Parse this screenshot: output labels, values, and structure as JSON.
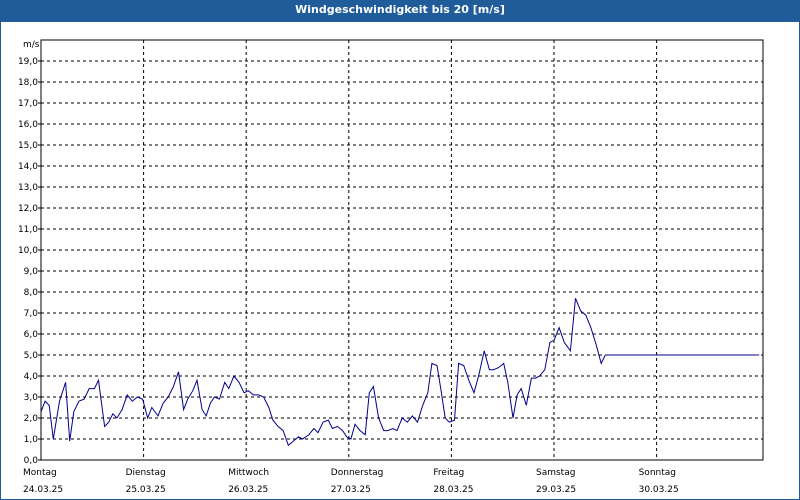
{
  "window": {
    "title": "Windgeschwindigkeit bis 20 [m/s]"
  },
  "chart_data": {
    "type": "line",
    "title": "Windgeschwindigkeit bis 20 [m/s]",
    "ylabel": "m/s",
    "ylim": [
      0,
      20
    ],
    "yticks": [
      "0,0",
      "1,0",
      "2,0",
      "3,0",
      "4,0",
      "5,0",
      "6,0",
      "7,0",
      "8,0",
      "9,0",
      "10,0",
      "11,0",
      "12,0",
      "13,0",
      "14,0",
      "15,0",
      "16,0",
      "17,0",
      "18,0",
      "19,0"
    ],
    "xlim_days": [
      0,
      7
    ],
    "grid": true,
    "line_color": "#00008b",
    "x_labels": [
      {
        "day": "Montag",
        "date": "24.03.25"
      },
      {
        "day": "Dienstag",
        "date": "25.03.25"
      },
      {
        "day": "Mittwoch",
        "date": "26.03.25"
      },
      {
        "day": "Donnerstag",
        "date": "27.03.25"
      },
      {
        "day": "Freitag",
        "date": "28.03.25"
      },
      {
        "day": "Samstag",
        "date": "29.03.25"
      },
      {
        "day": "Sonntag",
        "date": "30.03.25"
      }
    ],
    "series": [
      {
        "x": [
          0.0,
          0.04,
          0.08,
          0.12,
          0.18,
          0.24,
          0.28,
          0.32,
          0.37,
          0.42,
          0.47,
          0.52,
          0.56,
          0.62,
          0.66,
          0.7,
          0.74,
          0.79,
          0.84,
          0.89,
          0.94,
          0.99,
          1.04,
          1.08,
          1.14,
          1.19,
          1.24,
          1.29,
          1.34,
          1.39,
          1.43,
          1.48,
          1.52,
          1.57,
          1.61,
          1.65,
          1.69,
          1.74,
          1.79,
          1.83,
          1.88,
          1.93,
          1.98,
          2.02,
          2.07,
          2.12,
          2.17,
          2.22,
          2.26,
          2.31,
          2.36,
          2.41,
          2.46,
          2.51,
          2.55,
          2.61,
          2.66,
          2.7,
          2.75,
          2.8,
          2.84,
          2.89,
          2.94,
          2.98,
          3.02,
          3.06,
          3.11,
          3.16,
          3.2,
          3.24,
          3.29,
          3.34,
          3.38,
          3.43,
          3.47,
          3.52,
          3.57,
          3.62,
          3.67,
          3.72,
          3.77,
          3.81,
          3.86,
          3.9,
          3.94,
          3.98,
          4.03,
          4.07,
          4.12,
          4.17,
          4.22,
          4.27,
          4.32,
          4.37,
          4.41,
          4.46,
          4.51,
          4.55,
          4.6,
          4.64,
          4.68,
          4.73,
          4.78,
          4.82,
          4.86,
          4.91,
          4.96,
          5.0,
          5.05,
          5.1,
          5.16,
          5.21,
          5.26,
          5.31,
          5.36,
          5.41,
          5.46,
          5.5,
          5.56,
          5.61,
          5.66,
          5.71,
          5.76,
          5.81,
          5.86,
          5.9,
          5.95,
          6.0,
          6.04,
          6.09,
          6.14,
          6.19,
          6.24,
          6.29,
          6.34,
          6.38,
          6.43,
          6.48,
          6.52,
          6.57,
          6.62,
          6.67,
          6.71,
          6.76,
          6.81,
          6.86,
          6.9,
          6.95,
          7.0
        ],
        "y": [
          2.3,
          2.8,
          2.6,
          1.0,
          2.8,
          3.7,
          0.9,
          2.3,
          2.8,
          2.9,
          3.4,
          3.4,
          3.8,
          1.6,
          1.8,
          2.2,
          2.0,
          2.4,
          3.1,
          2.8,
          3.0,
          2.9,
          2.0,
          2.5,
          2.1,
          2.7,
          3.0,
          3.5,
          4.2,
          2.4,
          2.9,
          3.3,
          3.8,
          2.4,
          2.1,
          2.7,
          3.0,
          2.9,
          3.7,
          3.4,
          4.0,
          3.7,
          3.2,
          3.3,
          3.1,
          3.1,
          3.0,
          2.5,
          1.9,
          1.6,
          1.4,
          0.7,
          0.9,
          1.1,
          1.0,
          1.2,
          1.5,
          1.3,
          1.8,
          1.9,
          1.5,
          1.6,
          1.4,
          1.1,
          1.0,
          1.7,
          1.4,
          1.2,
          3.2,
          3.5,
          2.0,
          1.4,
          1.4,
          1.5,
          1.4,
          2.0,
          1.8,
          2.1,
          1.8,
          2.6,
          3.2,
          4.6,
          4.5,
          3.3,
          2.0,
          1.8,
          1.9,
          4.6,
          4.5,
          3.8,
          3.2,
          4.1,
          5.2,
          4.3,
          4.3,
          4.4,
          4.6,
          3.7,
          2.0,
          3.1,
          3.4,
          2.6,
          3.9,
          3.9,
          4.0,
          4.3,
          5.6,
          5.7,
          6.3,
          5.6,
          5.2,
          7.7,
          7.1,
          6.9,
          6.3,
          5.5,
          4.6,
          5.0,
          5.0,
          5.0,
          5.0,
          5.0,
          5.0,
          5.0,
          5.0,
          5.0,
          5.0,
          5.0,
          5.0,
          5.0,
          5.0,
          5.0,
          5.0,
          5.0,
          5.0,
          5.0,
          5.0,
          5.0,
          5.0,
          5.0,
          5.0,
          5.0,
          5.0,
          5.0,
          5.0,
          5.0,
          5.0,
          5.0,
          5.0
        ]
      }
    ]
  }
}
